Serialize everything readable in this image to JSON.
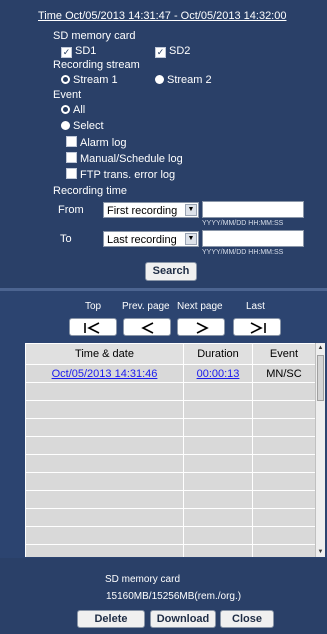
{
  "title": "Time Oct/05/2013 14:31:47 - Oct/05/2013 14:32:00",
  "sd_card": {
    "label": "SD memory card",
    "sd1": {
      "label": "SD1",
      "checked": true
    },
    "sd2": {
      "label": "SD2",
      "checked": true
    }
  },
  "recording_stream": {
    "label": "Recording stream",
    "stream1": {
      "label": "Stream 1",
      "selected": true
    },
    "stream2": {
      "label": "Stream 2",
      "selected": false
    }
  },
  "event": {
    "label": "Event",
    "all": {
      "label": "All",
      "selected": true
    },
    "select": {
      "label": "Select",
      "selected": false
    },
    "alarm_log": {
      "label": "Alarm log",
      "checked": false
    },
    "manual_log": {
      "label": "Manual/Schedule log",
      "checked": false
    },
    "ftp_log": {
      "label": "FTP trans. error log",
      "checked": false
    }
  },
  "recording_time": {
    "label": "Recording time",
    "from": {
      "label": "From",
      "selected": "First recording",
      "value": "",
      "hint": "YYYY/MM/DD HH:MM:SS"
    },
    "to": {
      "label": "To",
      "selected": "Last recording",
      "value": "",
      "hint": "YYYY/MM/DD HH:MM:SS"
    }
  },
  "search_button": "Search",
  "nav": {
    "top": "Top",
    "prev": "Prev. page",
    "next": "Next page",
    "last": "Last"
  },
  "table": {
    "headers": [
      "Time & date",
      "Duration",
      "Event"
    ],
    "rows": [
      {
        "time": "Oct/05/2013 14:31:46",
        "duration": "00:00:13",
        "event": "MN/SC"
      }
    ]
  },
  "footer": {
    "sd_label": "SD memory card",
    "capacity": "15160MB/15256MB(rem./org.)",
    "delete": "Delete",
    "download": "Download",
    "close": "Close"
  },
  "colors": {
    "background": "#243a5e",
    "link": "#1a1aee",
    "table_bg": "#d9d9d9"
  }
}
